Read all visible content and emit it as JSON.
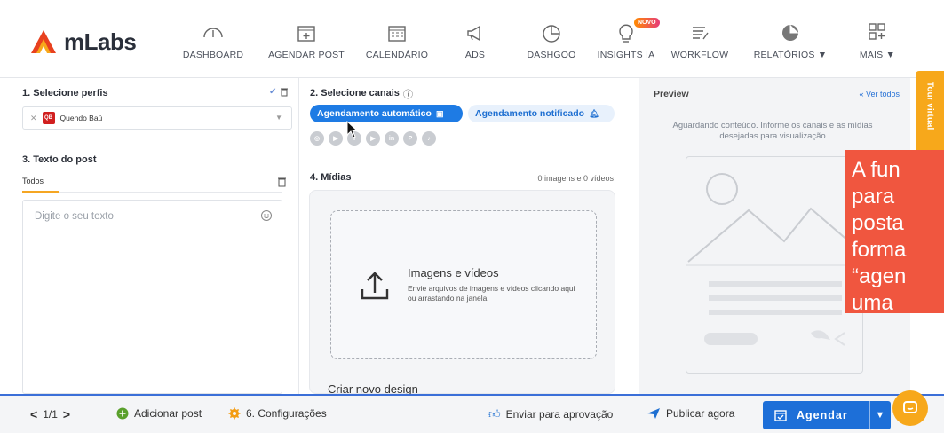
{
  "app": {
    "logo_text": "mLabs",
    "brand_colors": {
      "orange": "#f7a81b",
      "blue": "#1e7be4",
      "red": "#d11f1f"
    }
  },
  "nav": {
    "items": [
      {
        "label": "DASHBOARD",
        "icon": "gauge-icon"
      },
      {
        "label": "AGENDAR POST",
        "icon": "calendar-plus-icon"
      },
      {
        "label": "CALENDÁRIO",
        "icon": "calendar-icon"
      },
      {
        "label": "ADS",
        "icon": "megaphone-icon"
      },
      {
        "label": "DASHGOO",
        "icon": "pie-chart-icon"
      },
      {
        "label": "INSIGHTS IA",
        "icon": "lightbulb-icon",
        "badge": "NOVO"
      },
      {
        "label": "WORKFLOW",
        "icon": "workflow-icon"
      },
      {
        "label": "RELATÓRIOS ▼",
        "icon": "reports-icon"
      },
      {
        "label": "MAIS ▼",
        "icon": "apps-icon"
      }
    ]
  },
  "left": {
    "profiles_title": "1. Selecione perfis",
    "profile_chip": {
      "avatar": "QB",
      "name": "Quendo Baú"
    },
    "post_title": "3. Texto do post",
    "tab_todos": "Todos",
    "text_placeholder": "Digite o seu texto"
  },
  "middle": {
    "channels_title": "2. Selecione canais",
    "auto_label": "Agendamento automático",
    "notif_label": "Agendamento notificado",
    "socials": [
      "instagram",
      "youtube-shorts",
      "facebook",
      "youtube",
      "linkedin",
      "pinterest",
      "tiktok"
    ],
    "media_title": "4. Mídias",
    "media_count": "0 imagens e 0 vídeos",
    "drop_title": "Imagens e vídeos",
    "drop_desc": "Envie arquivos de imagens e vídeos clicando aqui ou arrastando na janela",
    "criar_design": "Criar novo design"
  },
  "preview": {
    "title": "Preview",
    "ver_todos": "« Ver todos",
    "message": "Aguardando conteúdo. Informe os canais e as mídias desejadas para visualização"
  },
  "tour_tab": "Tour virtual",
  "caption": {
    "lines": [
      "A fun",
      "para",
      "posta",
      "forma",
      "“agen",
      "uma"
    ]
  },
  "bottom": {
    "pager": "1/1",
    "add_post": "Adicionar post",
    "settings": "6. Configurações",
    "approval": "Enviar para aprovação",
    "publish_now": "Publicar agora",
    "agendar": "Agendar"
  }
}
